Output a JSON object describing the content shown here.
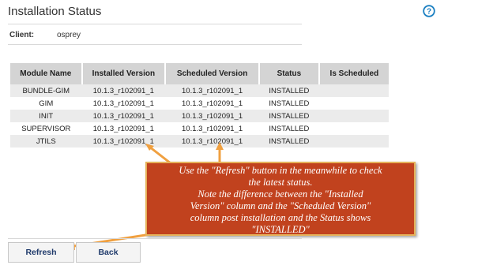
{
  "header": {
    "title": "Installation Status",
    "help_icon": "help-question-icon"
  },
  "client": {
    "label": "Client:",
    "value": "osprey"
  },
  "table": {
    "columns": [
      "Module Name",
      "Installed Version",
      "Scheduled Version",
      "Status",
      "Is Scheduled"
    ],
    "rows": [
      [
        "BUNDLE-GIM",
        "10.1.3_r102091_1",
        "10.1.3_r102091_1",
        "INSTALLED",
        ""
      ],
      [
        "GIM",
        "10.1.3_r102091_1",
        "10.1.3_r102091_1",
        "INSTALLED",
        ""
      ],
      [
        "INIT",
        "10.1.3_r102091_1",
        "10.1.3_r102091_1",
        "INSTALLED",
        ""
      ],
      [
        "SUPERVISOR",
        "10.1.3_r102091_1",
        "10.1.3_r102091_1",
        "INSTALLED",
        ""
      ],
      [
        "JTILS",
        "10.1.3_r102091_1",
        "10.1.3_r102091_1",
        "INSTALLED",
        ""
      ]
    ]
  },
  "callout": {
    "lines": [
      "Use the \"Refresh\" button in the meanwhile to check",
      "the latest status.",
      "Note the difference between the \"Installed",
      "Version\" column and the \"Scheduled Version\"",
      "column post installation and the Status shows",
      "\"INSTALLED\""
    ]
  },
  "buttons": {
    "refresh_label": "Refresh",
    "back_label": "Back"
  },
  "colors": {
    "callout_bg": "#c1421e",
    "callout_border": "#e6b25a",
    "arrow": "#f0a040",
    "help_icon": "#1a7fc1",
    "button_text": "#1f3a6b"
  }
}
